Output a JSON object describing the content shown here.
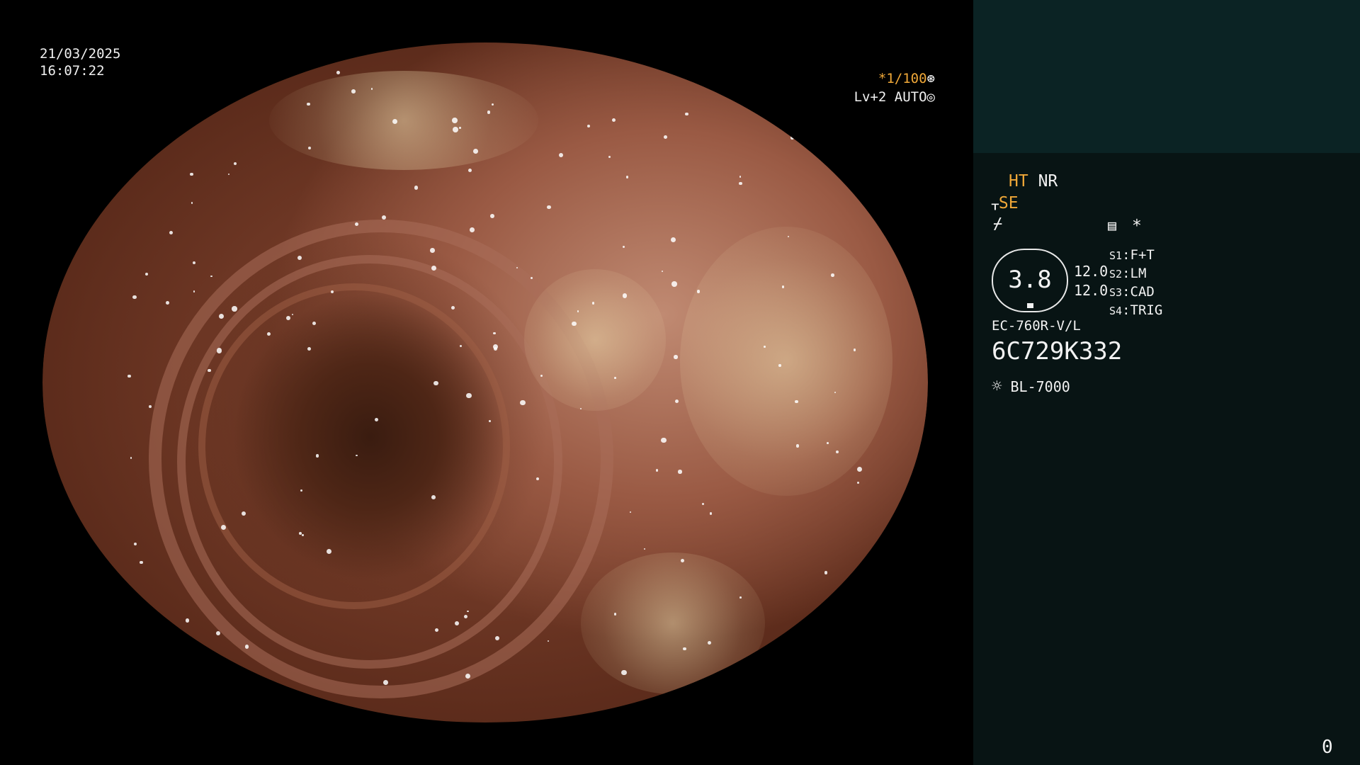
{
  "timestamp": {
    "date": "21/03/2025",
    "time": "16:07:22"
  },
  "overlay": {
    "shutter": "*1/100",
    "shutter_icon": "aperture-icon",
    "level": "Lv+2 AUTO",
    "level_icon": "iris-icon"
  },
  "panel": {
    "ht": "HT",
    "nr": "NR",
    "se": "SE",
    "gauge_value": "3.8",
    "side_values": [
      "12.0",
      "12.0"
    ],
    "switches": [
      {
        "key": "S1",
        "value": "F+T"
      },
      {
        "key": "S2",
        "value": "LM"
      },
      {
        "key": "S3",
        "value": "CAD"
      },
      {
        "key": "S4",
        "value": "TRIG"
      }
    ],
    "scope_model": "EC-760R-V/L",
    "serial": "6C729K332",
    "light_source": "BL-7000",
    "asterisk": "*"
  },
  "counter": "0",
  "colors": {
    "accent": "#f0a838",
    "panel_bg": "#081414",
    "panel_top": "#0b2324"
  }
}
